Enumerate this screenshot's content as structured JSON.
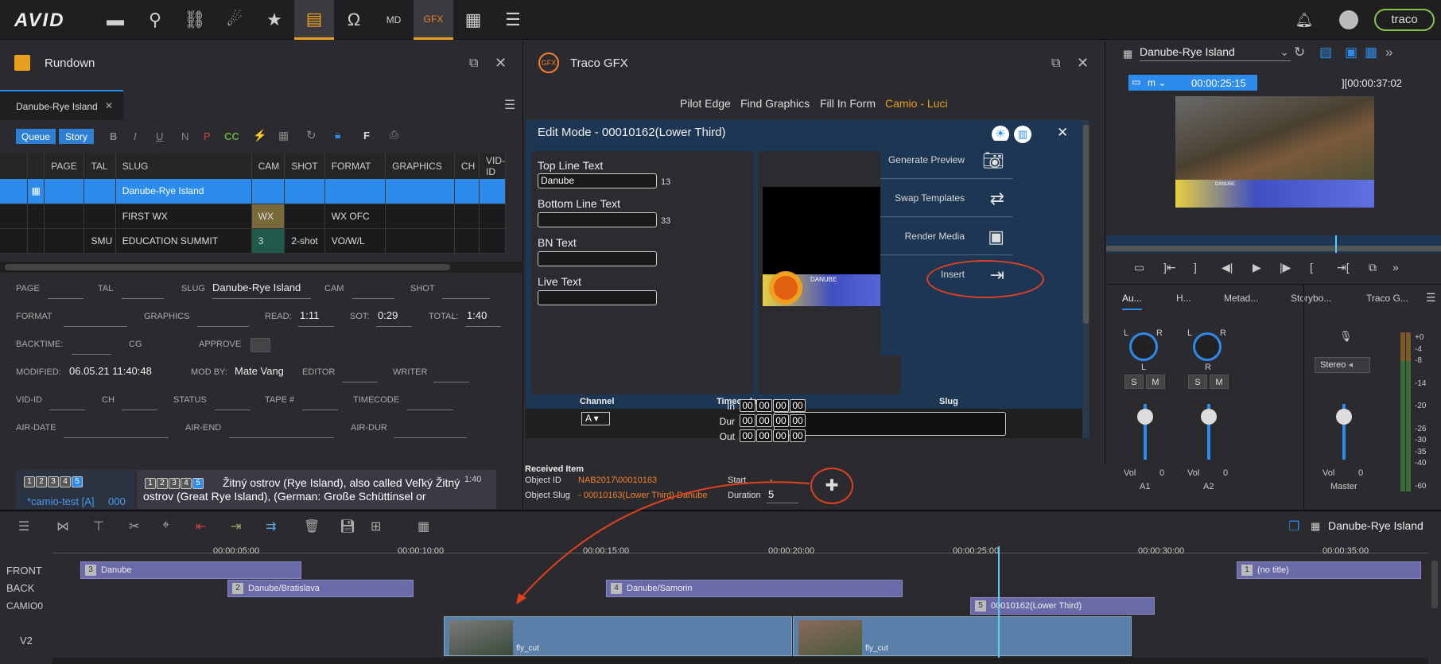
{
  "topbar": {
    "logo": "AVID",
    "brand": "traco"
  },
  "rundown": {
    "title": "Rundown",
    "tab": "Danube-Rye Island",
    "queue": "Queue",
    "story": "Story",
    "fmt": [
      "B",
      "I",
      "U",
      "N",
      "P",
      "CC"
    ],
    "fbtn": "F",
    "headers": [
      "PAGE",
      "TAL",
      "SLUG",
      "CAM",
      "SHOT",
      "FORMAT",
      "GRAPHICS",
      "CH",
      "VID-ID"
    ],
    "rows": [
      {
        "page": "",
        "tal": "",
        "slug": "Danube-Rye Island",
        "cam": "",
        "shot": "",
        "format": ""
      },
      {
        "page": "",
        "tal": "",
        "slug": "FIRST WX",
        "cam": "WX",
        "shot": "",
        "format": "WX OFC"
      },
      {
        "page": "",
        "tal": "SMU",
        "slug": "EDUCATION SUMMIT",
        "cam": "3",
        "shot": "2-shot",
        "format": "VO/W/L"
      }
    ]
  },
  "form": {
    "page": "PAGE",
    "tal": "TAL",
    "slug_label": "SLUG",
    "slug_value": "Danube-Rye Island",
    "cam": "CAM",
    "shot": "SHOT",
    "format": "FORMAT",
    "graphics": "GRAPHICS",
    "read_label": "READ:",
    "read_value": "1:11",
    "sot_label": "SOT:",
    "sot_value": "0:29",
    "total_label": "TOTAL:",
    "total_value": "1:40",
    "backtime": "BACKTIME:",
    "cg": "CG",
    "approve": "APPROVE",
    "modified_label": "MODIFIED:",
    "modified_value": "06.05.21 11:40:48",
    "modby_label": "MOD BY:",
    "modby_value": "Mate Vang",
    "editor": "EDITOR",
    "writer": "WRITER",
    "vidid": "VID-ID",
    "ch": "CH",
    "status": "STATUS",
    "tape": "TAPE #",
    "timecode": "TIMECODE",
    "airdate": "AIR-DATE",
    "airend": "AIR-END",
    "airdur": "AIR-DUR"
  },
  "story": {
    "nums": [
      "1",
      "2",
      "3",
      "4",
      "5"
    ],
    "camio": "*camio-test [A]",
    "camio_num": "000",
    "time": "1:40",
    "text": "Žitný ostrov (Rye Island), also called Veľký Žitný ostrov (Great Rye Island), (German: Große Schüttinsel or"
  },
  "gfx": {
    "logo": "GFX",
    "title": "Traco GFX",
    "tabs": [
      "Pilot Edge",
      "Find Graphics",
      "Fill In Form",
      "Camio - Luci"
    ],
    "edit_title": "Edit Mode - 00010162(Lower Third)",
    "fields": [
      {
        "label": "Top Line Text",
        "value": "Danube",
        "count": "13"
      },
      {
        "label": "Bottom Line Text",
        "value": "",
        "count": "33"
      },
      {
        "label": "BN Text",
        "value": "",
        "count": ""
      },
      {
        "label": "Live Text",
        "value": "",
        "count": ""
      }
    ],
    "preview_tag": "DANUBE",
    "actions": [
      "Generate Preview",
      "Swap Templates",
      "Render Media",
      "Insert"
    ],
    "channel_hdr": "Channel",
    "timecode_hdr": "Timecode",
    "slug_hdr": "Slug",
    "channel_value": "A",
    "tc_rows": [
      {
        "label": "In",
        "v": [
          "00",
          "00",
          "00",
          "00"
        ]
      },
      {
        "label": "Dur",
        "v": [
          "00",
          "00",
          "00",
          "00"
        ]
      },
      {
        "label": "Out",
        "v": [
          "00",
          "00",
          "00",
          "00"
        ]
      }
    ],
    "received_label": "Received Item",
    "objid_label": "Object ID",
    "objid_value": "NAB2017\\00010163",
    "objslug_label": "Object Slug",
    "objslug_value": "- 00010163(Lower Third) Danube",
    "start_label": "Start",
    "start_value": "-",
    "duration_label": "Duration",
    "duration_value": "5"
  },
  "player": {
    "sequence": "Danube-Rye Island",
    "mode": "m",
    "tc_current": "00:00:25:15",
    "tc_total": "00:00:37:02",
    "mini_label": "DANUBE"
  },
  "mixer": {
    "tabs": [
      "Au...",
      "H...",
      "Metad...",
      "Storybo...",
      "Traco G..."
    ],
    "ch": [
      {
        "l": "L",
        "r": "R",
        "bottom": "L",
        "vol": "Vol",
        "val": "0",
        "name": "A1"
      },
      {
        "l": "L",
        "r": "R",
        "bottom": "R",
        "vol": "Vol",
        "val": "0",
        "name": "A2"
      }
    ],
    "s": "S",
    "m": "M",
    "stereo": "Stereo",
    "master_vol": "Vol",
    "master_val": "0",
    "master": "Master",
    "scale": [
      "+0",
      "-4",
      "-8",
      "-14",
      "-20",
      "-26",
      "-30",
      "-35",
      "-40",
      "-60"
    ]
  },
  "timeline": {
    "sequence": "Danube-Rye Island",
    "ruler": [
      "00:00:05:00",
      "00:00:10:00",
      "00:00:15:00",
      "00:00:20:00",
      "00:00:25:00",
      "00:00:30:00",
      "00:00:35:00"
    ],
    "tracks": [
      "FRONT",
      "BACK",
      "CAMIO0",
      "V2"
    ],
    "clips": [
      {
        "num": "3",
        "name": "Danube"
      },
      {
        "num": "2",
        "name": "Danube/Bratislava"
      },
      {
        "num": "4",
        "name": "Danube/Samorin"
      },
      {
        "num": "5",
        "name": "00010162(Lower Third)"
      },
      {
        "num": "1",
        "name": "(no title)"
      }
    ],
    "vclips": [
      "fly_cut",
      "fly_cut"
    ]
  }
}
